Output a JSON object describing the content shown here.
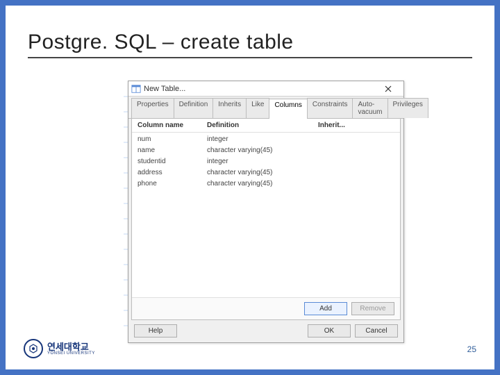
{
  "slide": {
    "title": "Postgre. SQL – create table",
    "page": "25",
    "logo_kr": "연세대학교",
    "logo_en": "YONSEI UNIVERSITY"
  },
  "dialog": {
    "title": "New Table...",
    "tabs": [
      "Properties",
      "Definition",
      "Inherits",
      "Like",
      "Columns",
      "Constraints",
      "Auto-vacuum",
      "Privileges"
    ],
    "active_tab_index": 4,
    "headers": {
      "c0": "Column name",
      "c1": "Definition",
      "c2": "Inherit..."
    },
    "rows": [
      {
        "name": "num",
        "def": "integer",
        "inh": ""
      },
      {
        "name": "name",
        "def": "character varying(45)",
        "inh": ""
      },
      {
        "name": "studentid",
        "def": "integer",
        "inh": ""
      },
      {
        "name": "address",
        "def": "character varying(45)",
        "inh": ""
      },
      {
        "name": "phone",
        "def": "character varying(45)",
        "inh": ""
      }
    ],
    "buttons": {
      "add": "Add",
      "remove": "Remove",
      "help": "Help",
      "ok": "OK",
      "cancel": "Cancel"
    }
  }
}
